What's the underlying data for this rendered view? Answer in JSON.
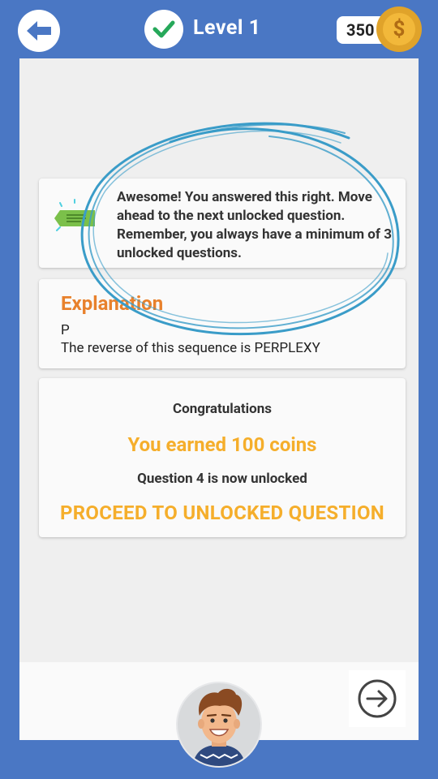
{
  "header": {
    "level_title": "Level 1",
    "coins": "350",
    "coin_symbol": "$"
  },
  "message": {
    "text": "Awesome! You answered this right. Move ahead to the next unlocked question. Remember, you always have a minimum of 3 unlocked questions."
  },
  "explanation": {
    "title": "Explanation",
    "answer": "P",
    "detail": "The reverse of this sequence is PERPLEXY"
  },
  "reward": {
    "title": "Congratulations",
    "earned": "You earned 100 coins",
    "unlocked": "Question 4 is now unlocked",
    "proceed": "PROCEED TO UNLOCKED QUESTION"
  },
  "colors": {
    "background": "#4a77c4",
    "accent_orange": "#e8812c",
    "accent_yellow": "#f5ae2b",
    "check_green": "#26a85a",
    "highlight_blue": "#3a9cc8"
  },
  "icons": {
    "back": "back-arrow-icon",
    "level_status": "check-icon",
    "coin": "coin-icon",
    "message": "ticket-icon",
    "next": "next-arrow-icon",
    "avatar": "avatar-icon"
  }
}
